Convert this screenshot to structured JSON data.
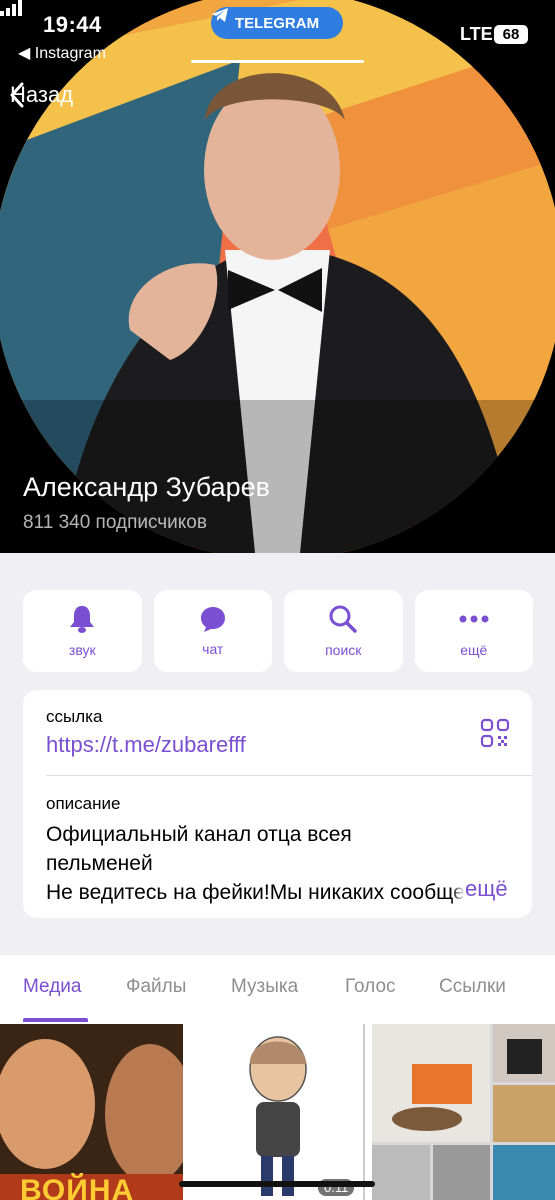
{
  "status_bar": {
    "time": "19:44",
    "back_app": "◀ Instagram",
    "pill_label": "TELEGRAM",
    "network": "LTE",
    "battery": "68"
  },
  "nav": {
    "back_label": "Назад"
  },
  "channel": {
    "name": "Александр Зубарев",
    "subscribers": "811 340 подписчиков"
  },
  "actions": [
    {
      "icon": "bell-icon",
      "label": "звук"
    },
    {
      "icon": "chat-bubble-icon",
      "label": "чат"
    },
    {
      "icon": "search-icon",
      "label": "поиск"
    },
    {
      "icon": "more-dots-icon",
      "label": "ещё"
    }
  ],
  "info": {
    "link_label": "ссылка",
    "link_value": "https://t.me/zubarefff",
    "description_label": "описание",
    "description_lines": [
      "Официальный канал отца всея",
      "пельменей",
      "Не ведитесь на фейки!Мы никаких сообщений"
    ],
    "more_label": "ещё"
  },
  "tabs": [
    "Медиа",
    "Файлы",
    "Музыка",
    "Голос",
    "Ссылки"
  ],
  "active_tab": "Медиа",
  "media": [
    {
      "kind": "poster",
      "caption": "ВОЙНА"
    },
    {
      "kind": "video",
      "duration": "0:11"
    },
    {
      "kind": "photo-collage"
    }
  ],
  "colors": {
    "accent": "#7a4fd1",
    "telegram_pill": "#2f7de0"
  }
}
